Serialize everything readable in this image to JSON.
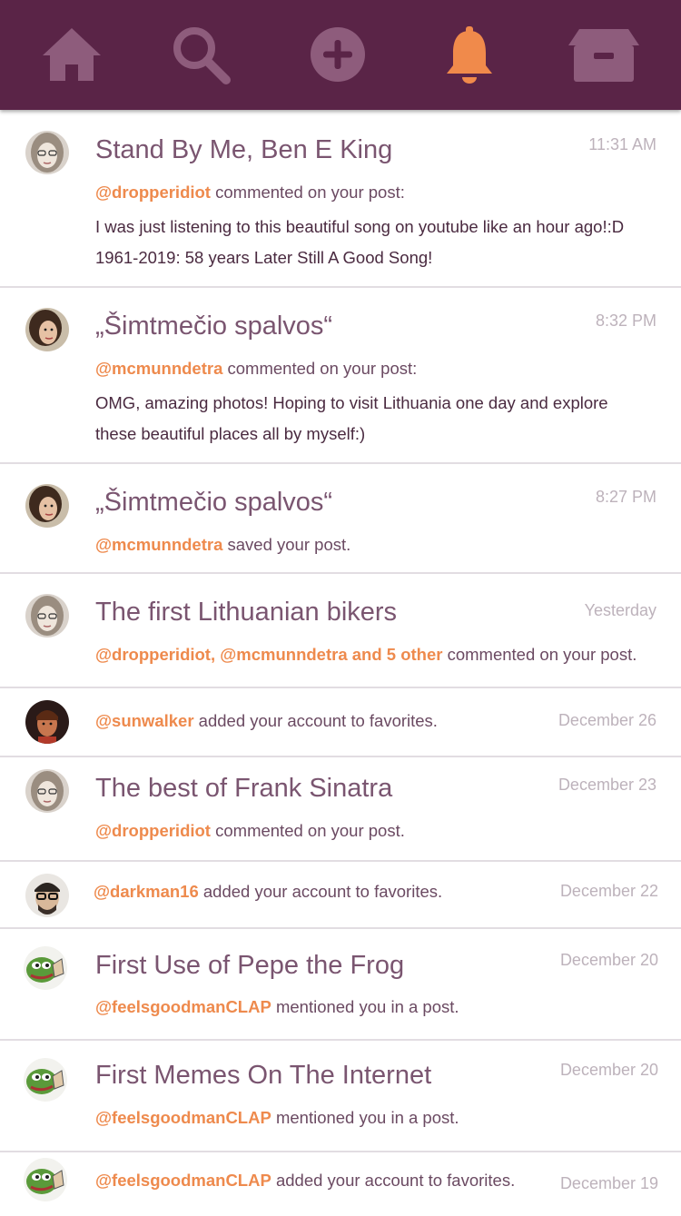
{
  "colors": {
    "nav_bg": "#5a2447",
    "nav_icon": "#8e5c7c",
    "nav_active": "#f08a4b",
    "username": "#ee8a4d",
    "title": "#7a5570",
    "time": "#bdb2bb"
  },
  "nav": {
    "items": [
      {
        "icon": "home-icon",
        "active": false
      },
      {
        "icon": "search-icon",
        "active": false
      },
      {
        "icon": "add-icon",
        "active": false
      },
      {
        "icon": "bell-icon",
        "active": true
      },
      {
        "icon": "archive-box-icon",
        "active": false
      }
    ]
  },
  "notifications": [
    {
      "title": "Stand By Me, Ben E King",
      "time": "11:31 AM",
      "user": "@dropperidiot",
      "action": " commented on your post:",
      "body_lines": [
        "I was just listening to this beautiful song on youtube like an hour ago!:D",
        "1961-2019: 58 years Later Still A Good Song!"
      ],
      "avatar": "avatar-woman-glasses"
    },
    {
      "title": "„Šimtmečio spalvos“",
      "time": "8:32 PM",
      "user": "@mcmunndetra",
      "action": " commented on your post:",
      "body_lines": [
        "OMG, amazing photos! Hoping to visit Lithuania one day and explore",
        "these beautiful places all by myself:)"
      ],
      "avatar": "avatar-woman-brunette"
    },
    {
      "title": "„Šimtmečio spalvos“",
      "time": "8:27 PM",
      "user": "@mcmunndetra",
      "action": " saved your post.",
      "avatar": "avatar-woman-brunette"
    },
    {
      "title": "The first Lithuanian bikers",
      "time": "Yesterday",
      "user": "@dropperidiot, @mcmunndetra and 5 other",
      "action": " commented on your post.",
      "avatar": "avatar-woman-glasses"
    },
    {
      "title": "",
      "time": "December 26",
      "user": "@sunwalker",
      "action": " added your account to favorites.",
      "avatar": "avatar-man-red"
    },
    {
      "title": "The best of Frank Sinatra",
      "time": "December 23",
      "user": "@dropperidiot",
      "action": " commented on your post.",
      "avatar": "avatar-woman-glasses"
    },
    {
      "title": "",
      "time": "December 22",
      "user": "@darkman16",
      "action": " added your account to favorites.",
      "avatar": "avatar-man-glasses"
    },
    {
      "title": "First Use of Pepe the Frog",
      "time": "December 20",
      "user": "@feelsgoodmanCLAP",
      "action": " mentioned you in a post.",
      "avatar": "avatar-pepe"
    },
    {
      "title": "First Memes On The Internet",
      "time": "December 20",
      "user": "@feelsgoodmanCLAP",
      "action": " mentioned you in a post.",
      "avatar": "avatar-pepe"
    },
    {
      "title": "",
      "time": "December 19",
      "user": "@feelsgoodmanCLAP",
      "action": " added your account to favorites.",
      "avatar": "avatar-pepe"
    }
  ]
}
